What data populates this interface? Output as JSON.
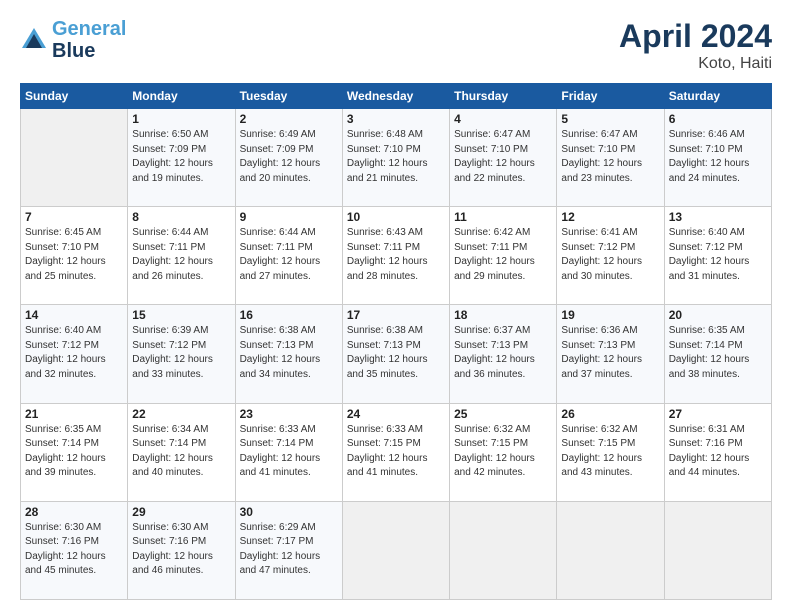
{
  "header": {
    "logo_line1": "General",
    "logo_line2": "Blue",
    "title": "April 2024",
    "subtitle": "Koto, Haiti"
  },
  "days_of_week": [
    "Sunday",
    "Monday",
    "Tuesday",
    "Wednesday",
    "Thursday",
    "Friday",
    "Saturday"
  ],
  "weeks": [
    [
      {
        "day": "",
        "info": ""
      },
      {
        "day": "1",
        "info": "Sunrise: 6:50 AM\nSunset: 7:09 PM\nDaylight: 12 hours\nand 19 minutes."
      },
      {
        "day": "2",
        "info": "Sunrise: 6:49 AM\nSunset: 7:09 PM\nDaylight: 12 hours\nand 20 minutes."
      },
      {
        "day": "3",
        "info": "Sunrise: 6:48 AM\nSunset: 7:10 PM\nDaylight: 12 hours\nand 21 minutes."
      },
      {
        "day": "4",
        "info": "Sunrise: 6:47 AM\nSunset: 7:10 PM\nDaylight: 12 hours\nand 22 minutes."
      },
      {
        "day": "5",
        "info": "Sunrise: 6:47 AM\nSunset: 7:10 PM\nDaylight: 12 hours\nand 23 minutes."
      },
      {
        "day": "6",
        "info": "Sunrise: 6:46 AM\nSunset: 7:10 PM\nDaylight: 12 hours\nand 24 minutes."
      }
    ],
    [
      {
        "day": "7",
        "info": "Sunrise: 6:45 AM\nSunset: 7:10 PM\nDaylight: 12 hours\nand 25 minutes."
      },
      {
        "day": "8",
        "info": "Sunrise: 6:44 AM\nSunset: 7:11 PM\nDaylight: 12 hours\nand 26 minutes."
      },
      {
        "day": "9",
        "info": "Sunrise: 6:44 AM\nSunset: 7:11 PM\nDaylight: 12 hours\nand 27 minutes."
      },
      {
        "day": "10",
        "info": "Sunrise: 6:43 AM\nSunset: 7:11 PM\nDaylight: 12 hours\nand 28 minutes."
      },
      {
        "day": "11",
        "info": "Sunrise: 6:42 AM\nSunset: 7:11 PM\nDaylight: 12 hours\nand 29 minutes."
      },
      {
        "day": "12",
        "info": "Sunrise: 6:41 AM\nSunset: 7:12 PM\nDaylight: 12 hours\nand 30 minutes."
      },
      {
        "day": "13",
        "info": "Sunrise: 6:40 AM\nSunset: 7:12 PM\nDaylight: 12 hours\nand 31 minutes."
      }
    ],
    [
      {
        "day": "14",
        "info": "Sunrise: 6:40 AM\nSunset: 7:12 PM\nDaylight: 12 hours\nand 32 minutes."
      },
      {
        "day": "15",
        "info": "Sunrise: 6:39 AM\nSunset: 7:12 PM\nDaylight: 12 hours\nand 33 minutes."
      },
      {
        "day": "16",
        "info": "Sunrise: 6:38 AM\nSunset: 7:13 PM\nDaylight: 12 hours\nand 34 minutes."
      },
      {
        "day": "17",
        "info": "Sunrise: 6:38 AM\nSunset: 7:13 PM\nDaylight: 12 hours\nand 35 minutes."
      },
      {
        "day": "18",
        "info": "Sunrise: 6:37 AM\nSunset: 7:13 PM\nDaylight: 12 hours\nand 36 minutes."
      },
      {
        "day": "19",
        "info": "Sunrise: 6:36 AM\nSunset: 7:13 PM\nDaylight: 12 hours\nand 37 minutes."
      },
      {
        "day": "20",
        "info": "Sunrise: 6:35 AM\nSunset: 7:14 PM\nDaylight: 12 hours\nand 38 minutes."
      }
    ],
    [
      {
        "day": "21",
        "info": "Sunrise: 6:35 AM\nSunset: 7:14 PM\nDaylight: 12 hours\nand 39 minutes."
      },
      {
        "day": "22",
        "info": "Sunrise: 6:34 AM\nSunset: 7:14 PM\nDaylight: 12 hours\nand 40 minutes."
      },
      {
        "day": "23",
        "info": "Sunrise: 6:33 AM\nSunset: 7:14 PM\nDaylight: 12 hours\nand 41 minutes."
      },
      {
        "day": "24",
        "info": "Sunrise: 6:33 AM\nSunset: 7:15 PM\nDaylight: 12 hours\nand 41 minutes."
      },
      {
        "day": "25",
        "info": "Sunrise: 6:32 AM\nSunset: 7:15 PM\nDaylight: 12 hours\nand 42 minutes."
      },
      {
        "day": "26",
        "info": "Sunrise: 6:32 AM\nSunset: 7:15 PM\nDaylight: 12 hours\nand 43 minutes."
      },
      {
        "day": "27",
        "info": "Sunrise: 6:31 AM\nSunset: 7:16 PM\nDaylight: 12 hours\nand 44 minutes."
      }
    ],
    [
      {
        "day": "28",
        "info": "Sunrise: 6:30 AM\nSunset: 7:16 PM\nDaylight: 12 hours\nand 45 minutes."
      },
      {
        "day": "29",
        "info": "Sunrise: 6:30 AM\nSunset: 7:16 PM\nDaylight: 12 hours\nand 46 minutes."
      },
      {
        "day": "30",
        "info": "Sunrise: 6:29 AM\nSunset: 7:17 PM\nDaylight: 12 hours\nand 47 minutes."
      },
      {
        "day": "",
        "info": ""
      },
      {
        "day": "",
        "info": ""
      },
      {
        "day": "",
        "info": ""
      },
      {
        "day": "",
        "info": ""
      }
    ]
  ]
}
